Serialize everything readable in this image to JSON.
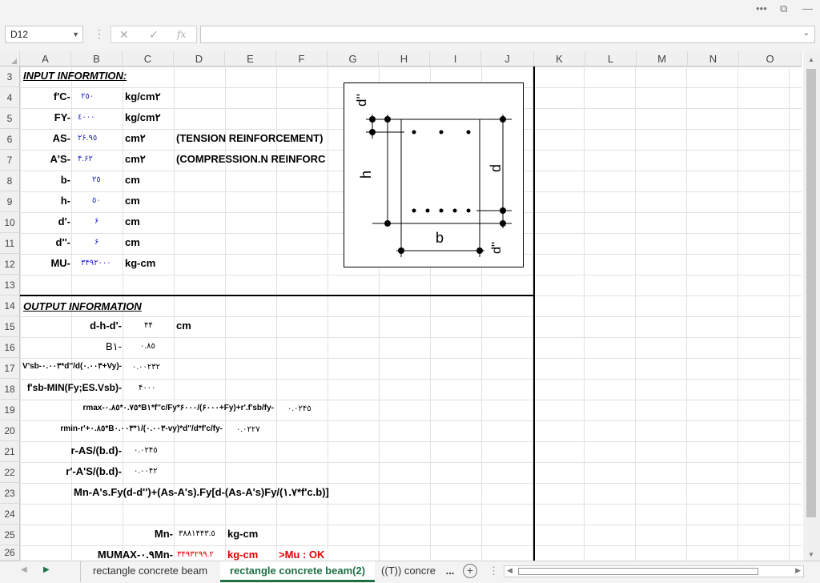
{
  "window": {
    "menu_glyph": "•••",
    "restore_glyph": "⧉",
    "min_glyph": "—"
  },
  "formula_bar": {
    "name_box": "D12",
    "cancel": "✕",
    "enter": "✓",
    "fx": "fx",
    "formula": ""
  },
  "columns": [
    "A",
    "B",
    "C",
    "D",
    "E",
    "F",
    "G",
    "H",
    "I",
    "J",
    "K",
    "L",
    "M",
    "N",
    "O"
  ],
  "rows": [
    "3",
    "4",
    "5",
    "6",
    "7",
    "8",
    "9",
    "10",
    "11",
    "12",
    "13",
    "14",
    "15",
    "16",
    "17",
    "18",
    "19",
    "20",
    "21",
    "22",
    "23",
    "24",
    "25",
    "26"
  ],
  "input": {
    "title": "INPUT INFORMTION:",
    "fc_label": "f'C-",
    "fc_value": "٢٥٠",
    "fc_unit": "kg/cm٢",
    "fy_label": "FY-",
    "fy_value": "٤٠٠٠",
    "fy_unit": "kg/cm٢",
    "as_label": "AS-",
    "as_value": "٢۶.٩٥",
    "as_unit": "cm٢",
    "as_note": "(TENSION REINFORCEMENT)",
    "asp_label": "A'S-",
    "asp_value": "۴.۶٢",
    "asp_unit": "cm٢",
    "asp_note": "(COMPRESSION.N REINFORC",
    "b_label": "b-",
    "b_value": "٢٥",
    "b_unit": "cm",
    "h_label": "h-",
    "h_value": "٥٠",
    "h_unit": "cm",
    "dp_label": "d'-",
    "dp_value": "۶",
    "dp_unit": "cm",
    "dpp_label": "d''-",
    "dpp_value": "۶",
    "dpp_unit": "cm",
    "mu_label": "MU-",
    "mu_value": "٣۴۹٢٠٠٠",
    "mu_unit": "kg-cm"
  },
  "output": {
    "title": "OUTPUT INFORMATION",
    "r15_label": "d-h-d'-",
    "r15_value": "۴۴",
    "r15_unit": "cm",
    "r16_label": "B١-",
    "r16_value": "٠.٨٥",
    "r17_label": "V'sb-٠.٠٠٣*d''/d(٠.٠٠٣+Vy)-",
    "r17_value": "٠.٠٠٢٣٢",
    "r18_label": "f'sb-MIN(Fy;ES.Vsb)-",
    "r18_value": "۴٠٠٠",
    "r19_label": "rmax-٠.٧٥*٠.٨٥*B١*f''c/Fy*۶٠٠٠/(۶٠٠٠+Fy)+r'.f'sb/fy-",
    "r19_value": "٠.٠٢۴٥",
    "r20_label": "rmin-r'+٠.٨٥*B١*٠.٠٠٣/(٠.٠٠٣-vy)*d''/d*f'c/fy-",
    "r20_value": "٠.٠٢٢٧",
    "r21_label": "r-AS/(b.d)-",
    "r21_value": "٠.٠٢۴٥",
    "r22_label": "r'-A'S/(b.d)-",
    "r22_value": "٠.٠٠۴٢",
    "r23_formula": "Mn-A's.Fy(d-d'')+(As-A's).Fy[d-(As-A's)Fy/(١.٧*f'c.b)]",
    "r25_label": "Mn-",
    "r25_value": "٣٨٨١۴۴٣.٥",
    "r25_unit": "kg-cm",
    "r26_label": "MUMAX-٠.٩Mn-",
    "r26_value": "٣۴۹٣٢۹۹.٢",
    "r26_unit": "kg-cm",
    "r26_check": ">Mu : OK"
  },
  "diagram": {
    "label_dpp_top": "d''",
    "label_h": "h",
    "label_d": "d",
    "label_b": "b",
    "label_dpp_bottom": "d''"
  },
  "sheet_tabs": {
    "tab1": "rectangle concrete beam",
    "tab2": "rectangle concrete beam(2)",
    "tab3": "((T)) concre",
    "more": "...",
    "add": "+"
  }
}
